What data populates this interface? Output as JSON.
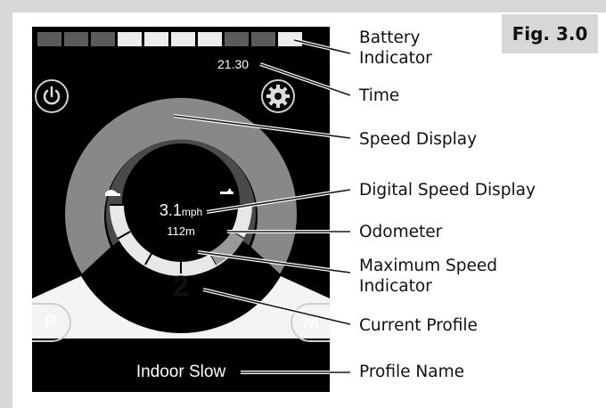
{
  "figure_tag": "Fig. 3.0",
  "screen": {
    "battery": {
      "segments": [
        "#5b5b5b",
        "#5b5b5b",
        "#5b5b5b",
        "#ececec",
        "#ececec",
        "#ececec",
        "#ececec",
        "#5b5b5b",
        "#5b5b5b",
        "#ececec"
      ]
    },
    "time": "21.30",
    "power_button_icon": "power-icon",
    "settings_button_icon": "gear-icon",
    "speed_value": "3.1",
    "speed_unit": "mph",
    "odometer": "112m",
    "profile_number": "2",
    "profile_name": "Indoor Slow",
    "left_button_label": "P",
    "right_button_label": "M",
    "slow_icon": "tortoise-icon",
    "fast_icon": "hare-icon"
  },
  "callouts": {
    "battery_line1": "Battery",
    "battery_line2": "Indicator",
    "time": "Time",
    "speed_display": "Speed Display",
    "digital_speed": "Digital Speed Display",
    "odometer": "Odometer",
    "max_speed_line1": "Maximum Speed",
    "max_speed_line2": "Indicator",
    "current_profile": "Current Profile",
    "profile_name": "Profile Name"
  },
  "colors": {
    "screen_bg": "#000000",
    "outer_ring": "#888888",
    "inner_ring": "#4a4a4a",
    "profile_band": "#f4f4f4",
    "frame_grey": "#d7d7d7"
  }
}
